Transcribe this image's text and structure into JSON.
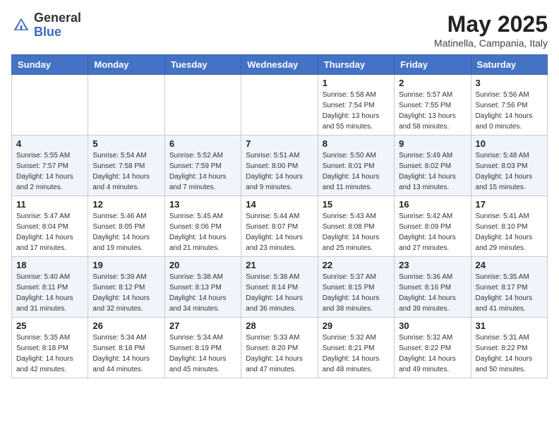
{
  "header": {
    "logo_general": "General",
    "logo_blue": "Blue",
    "month_year": "May 2025",
    "location": "Matinella, Campania, Italy"
  },
  "weekdays": [
    "Sunday",
    "Monday",
    "Tuesday",
    "Wednesday",
    "Thursday",
    "Friday",
    "Saturday"
  ],
  "weeks": [
    [
      {
        "day": "",
        "info": ""
      },
      {
        "day": "",
        "info": ""
      },
      {
        "day": "",
        "info": ""
      },
      {
        "day": "",
        "info": ""
      },
      {
        "day": "1",
        "info": "Sunrise: 5:58 AM\nSunset: 7:54 PM\nDaylight: 13 hours\nand 55 minutes."
      },
      {
        "day": "2",
        "info": "Sunrise: 5:57 AM\nSunset: 7:55 PM\nDaylight: 13 hours\nand 58 minutes."
      },
      {
        "day": "3",
        "info": "Sunrise: 5:56 AM\nSunset: 7:56 PM\nDaylight: 14 hours\nand 0 minutes."
      }
    ],
    [
      {
        "day": "4",
        "info": "Sunrise: 5:55 AM\nSunset: 7:57 PM\nDaylight: 14 hours\nand 2 minutes."
      },
      {
        "day": "5",
        "info": "Sunrise: 5:54 AM\nSunset: 7:58 PM\nDaylight: 14 hours\nand 4 minutes."
      },
      {
        "day": "6",
        "info": "Sunrise: 5:52 AM\nSunset: 7:59 PM\nDaylight: 14 hours\nand 7 minutes."
      },
      {
        "day": "7",
        "info": "Sunrise: 5:51 AM\nSunset: 8:00 PM\nDaylight: 14 hours\nand 9 minutes."
      },
      {
        "day": "8",
        "info": "Sunrise: 5:50 AM\nSunset: 8:01 PM\nDaylight: 14 hours\nand 11 minutes."
      },
      {
        "day": "9",
        "info": "Sunrise: 5:49 AM\nSunset: 8:02 PM\nDaylight: 14 hours\nand 13 minutes."
      },
      {
        "day": "10",
        "info": "Sunrise: 5:48 AM\nSunset: 8:03 PM\nDaylight: 14 hours\nand 15 minutes."
      }
    ],
    [
      {
        "day": "11",
        "info": "Sunrise: 5:47 AM\nSunset: 8:04 PM\nDaylight: 14 hours\nand 17 minutes."
      },
      {
        "day": "12",
        "info": "Sunrise: 5:46 AM\nSunset: 8:05 PM\nDaylight: 14 hours\nand 19 minutes."
      },
      {
        "day": "13",
        "info": "Sunrise: 5:45 AM\nSunset: 8:06 PM\nDaylight: 14 hours\nand 21 minutes."
      },
      {
        "day": "14",
        "info": "Sunrise: 5:44 AM\nSunset: 8:07 PM\nDaylight: 14 hours\nand 23 minutes."
      },
      {
        "day": "15",
        "info": "Sunrise: 5:43 AM\nSunset: 8:08 PM\nDaylight: 14 hours\nand 25 minutes."
      },
      {
        "day": "16",
        "info": "Sunrise: 5:42 AM\nSunset: 8:09 PM\nDaylight: 14 hours\nand 27 minutes."
      },
      {
        "day": "17",
        "info": "Sunrise: 5:41 AM\nSunset: 8:10 PM\nDaylight: 14 hours\nand 29 minutes."
      }
    ],
    [
      {
        "day": "18",
        "info": "Sunrise: 5:40 AM\nSunset: 8:11 PM\nDaylight: 14 hours\nand 31 minutes."
      },
      {
        "day": "19",
        "info": "Sunrise: 5:39 AM\nSunset: 8:12 PM\nDaylight: 14 hours\nand 32 minutes."
      },
      {
        "day": "20",
        "info": "Sunrise: 5:38 AM\nSunset: 8:13 PM\nDaylight: 14 hours\nand 34 minutes."
      },
      {
        "day": "21",
        "info": "Sunrise: 5:38 AM\nSunset: 8:14 PM\nDaylight: 14 hours\nand 36 minutes."
      },
      {
        "day": "22",
        "info": "Sunrise: 5:37 AM\nSunset: 8:15 PM\nDaylight: 14 hours\nand 38 minutes."
      },
      {
        "day": "23",
        "info": "Sunrise: 5:36 AM\nSunset: 8:16 PM\nDaylight: 14 hours\nand 39 minutes."
      },
      {
        "day": "24",
        "info": "Sunrise: 5:35 AM\nSunset: 8:17 PM\nDaylight: 14 hours\nand 41 minutes."
      }
    ],
    [
      {
        "day": "25",
        "info": "Sunrise: 5:35 AM\nSunset: 8:18 PM\nDaylight: 14 hours\nand 42 minutes."
      },
      {
        "day": "26",
        "info": "Sunrise: 5:34 AM\nSunset: 8:18 PM\nDaylight: 14 hours\nand 44 minutes."
      },
      {
        "day": "27",
        "info": "Sunrise: 5:34 AM\nSunset: 8:19 PM\nDaylight: 14 hours\nand 45 minutes."
      },
      {
        "day": "28",
        "info": "Sunrise: 5:33 AM\nSunset: 8:20 PM\nDaylight: 14 hours\nand 47 minutes."
      },
      {
        "day": "29",
        "info": "Sunrise: 5:32 AM\nSunset: 8:21 PM\nDaylight: 14 hours\nand 48 minutes."
      },
      {
        "day": "30",
        "info": "Sunrise: 5:32 AM\nSunset: 8:22 PM\nDaylight: 14 hours\nand 49 minutes."
      },
      {
        "day": "31",
        "info": "Sunrise: 5:31 AM\nSunset: 8:22 PM\nDaylight: 14 hours\nand 50 minutes."
      }
    ]
  ]
}
